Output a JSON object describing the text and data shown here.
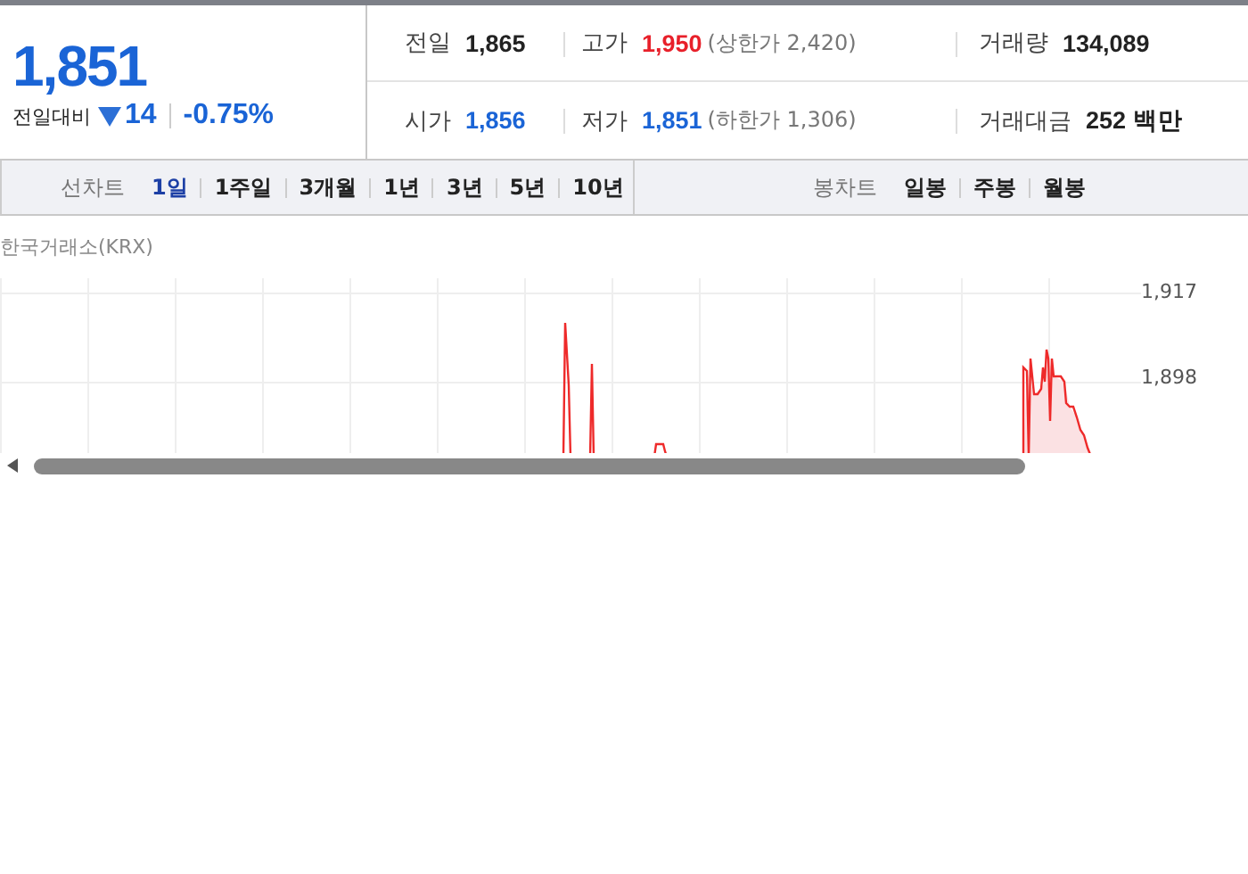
{
  "quote": {
    "price": "1,851",
    "change_label": "전일대비",
    "falling": true,
    "change": "14",
    "change_rate": "-0.75%"
  },
  "stats": [
    {
      "label": "전일",
      "value": "1,865",
      "color": "#222222"
    },
    {
      "label": "고가",
      "value": "1,950",
      "color": "#e8202a",
      "note": "(상한가 2,420)"
    },
    {
      "label": "거래량",
      "value": "134,089",
      "color": "#222222"
    },
    {
      "label": "시가",
      "value": "1,856",
      "color": "#1a64d6"
    },
    {
      "label": "저가",
      "value": "1,851",
      "color": "#1a64d6",
      "note": "(하한가 1,306)"
    },
    {
      "label": "거래대금",
      "value": "252 백만",
      "color": "#222222"
    }
  ],
  "line_chart": {
    "label": "선차트",
    "periods": [
      {
        "label": "1일",
        "selected": true
      },
      {
        "label": "1주일",
        "selected": false
      },
      {
        "label": "3개월",
        "selected": false
      },
      {
        "label": "1년",
        "selected": false
      },
      {
        "label": "3년",
        "selected": false
      },
      {
        "label": "5년",
        "selected": false
      },
      {
        "label": "10년",
        "selected": false
      }
    ]
  },
  "candle_chart": {
    "label": "봉차트",
    "periods": [
      {
        "label": "일봉",
        "selected": false
      },
      {
        "label": "주봉",
        "selected": false
      },
      {
        "label": "월봉",
        "selected": false
      }
    ]
  },
  "chart": {
    "source": "한국거래소(KRX)",
    "y_labels": [
      "1,917",
      "1,898"
    ]
  }
}
